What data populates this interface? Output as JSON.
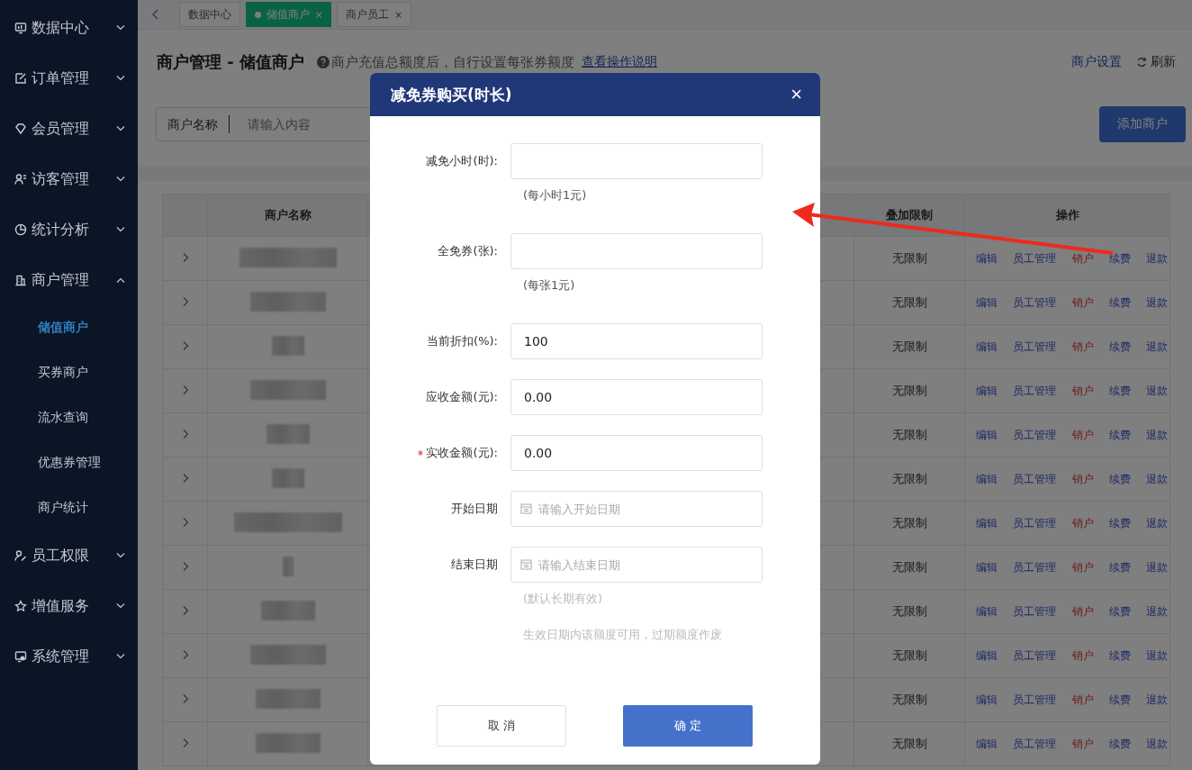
{
  "sidebar": {
    "items": [
      {
        "label": "数据中心",
        "expanded": false
      },
      {
        "label": "订单管理",
        "expanded": false
      },
      {
        "label": "会员管理",
        "expanded": false
      },
      {
        "label": "访客管理",
        "expanded": false
      },
      {
        "label": "统计分析",
        "expanded": false
      },
      {
        "label": "商户管理",
        "expanded": true,
        "children": [
          {
            "label": "储值商户",
            "selected": true
          },
          {
            "label": "买券商户",
            "selected": false
          },
          {
            "label": "流水查询",
            "selected": false
          },
          {
            "label": "优惠券管理",
            "selected": false
          },
          {
            "label": "商户统计",
            "selected": false
          }
        ]
      },
      {
        "label": "员工权限",
        "expanded": false
      },
      {
        "label": "增值服务",
        "expanded": false
      },
      {
        "label": "系统管理",
        "expanded": false
      }
    ]
  },
  "tabs": [
    {
      "label": "数据中心",
      "selected": false,
      "closable": false
    },
    {
      "label": "储值商户",
      "selected": true,
      "closable": true,
      "close": "×"
    },
    {
      "label": "商户员工",
      "selected": false,
      "closable": true,
      "close": "×"
    }
  ],
  "header": {
    "title": "商户管理 - 储值商户",
    "help": "商户充值总额度后，自行设置每张券额度",
    "help_link": "查看操作说明",
    "settings_link": "商户设置",
    "refresh": "刷新"
  },
  "filter": {
    "label": "商户名称",
    "placeholder": "请输入内容",
    "add_button": "添加商户"
  },
  "table": {
    "columns": [
      "商户名称",
      "叠加限制",
      "操作"
    ],
    "rows": [
      {
        "limit": "无限制",
        "actions": [
          {
            "label": "编辑",
            "kind": "link"
          },
          {
            "label": "员工管理",
            "kind": "link"
          },
          {
            "label": "销户",
            "kind": "danger"
          },
          {
            "label": "续费",
            "kind": "link"
          },
          {
            "label": "退款",
            "kind": "link"
          }
        ]
      },
      {
        "limit": "无限制",
        "actions": [
          {
            "label": "编辑",
            "kind": "link"
          },
          {
            "label": "员工管理",
            "kind": "link"
          },
          {
            "label": "销户",
            "kind": "danger"
          },
          {
            "label": "续费",
            "kind": "link"
          },
          {
            "label": "退款",
            "kind": "link"
          }
        ]
      },
      {
        "limit": "无限制",
        "actions": [
          {
            "label": "编辑",
            "kind": "link"
          },
          {
            "label": "员工管理",
            "kind": "link"
          },
          {
            "label": "销户",
            "kind": "danger"
          },
          {
            "label": "续费",
            "kind": "link"
          },
          {
            "label": "退款",
            "kind": "link"
          }
        ]
      },
      {
        "limit": "无限制",
        "actions": [
          {
            "label": "编辑",
            "kind": "link"
          },
          {
            "label": "员工管理",
            "kind": "link"
          },
          {
            "label": "销户",
            "kind": "danger"
          },
          {
            "label": "续费",
            "kind": "link"
          },
          {
            "label": "退款",
            "kind": "link"
          }
        ]
      },
      {
        "limit": "无限制",
        "actions": [
          {
            "label": "编辑",
            "kind": "link"
          },
          {
            "label": "员工管理",
            "kind": "link"
          },
          {
            "label": "销户",
            "kind": "danger"
          },
          {
            "label": "续费",
            "kind": "link"
          },
          {
            "label": "退款",
            "kind": "link"
          }
        ]
      },
      {
        "limit": "无限制",
        "actions": [
          {
            "label": "编辑",
            "kind": "link"
          },
          {
            "label": "员工管理",
            "kind": "link"
          },
          {
            "label": "销户",
            "kind": "danger"
          },
          {
            "label": "续费",
            "kind": "link"
          },
          {
            "label": "退款",
            "kind": "link"
          }
        ]
      },
      {
        "limit": "无限制",
        "actions": [
          {
            "label": "编辑",
            "kind": "link"
          },
          {
            "label": "员工管理",
            "kind": "link"
          },
          {
            "label": "销户",
            "kind": "danger"
          },
          {
            "label": "续费",
            "kind": "link"
          },
          {
            "label": "退款",
            "kind": "link"
          }
        ]
      },
      {
        "limit": "无限制",
        "actions": [
          {
            "label": "编辑",
            "kind": "link"
          },
          {
            "label": "员工管理",
            "kind": "link"
          },
          {
            "label": "销户",
            "kind": "danger"
          },
          {
            "label": "续费",
            "kind": "link"
          },
          {
            "label": "退款",
            "kind": "link"
          }
        ]
      },
      {
        "limit": "无限制",
        "actions": [
          {
            "label": "编辑",
            "kind": "link"
          },
          {
            "label": "员工管理",
            "kind": "link"
          },
          {
            "label": "销户",
            "kind": "danger"
          },
          {
            "label": "续费",
            "kind": "link"
          },
          {
            "label": "退款",
            "kind": "link"
          }
        ]
      },
      {
        "limit": "无限制",
        "actions": [
          {
            "label": "编辑",
            "kind": "link"
          },
          {
            "label": "员工管理",
            "kind": "link"
          },
          {
            "label": "销户",
            "kind": "danger"
          },
          {
            "label": "续费",
            "kind": "link"
          },
          {
            "label": "退款",
            "kind": "link"
          }
        ]
      },
      {
        "limit": "无限制",
        "actions": [
          {
            "label": "编辑",
            "kind": "link"
          },
          {
            "label": "员工管理",
            "kind": "link"
          },
          {
            "label": "销户",
            "kind": "danger"
          },
          {
            "label": "续费",
            "kind": "link"
          },
          {
            "label": "退款",
            "kind": "link"
          }
        ]
      },
      {
        "limit": "无限制",
        "actions": [
          {
            "label": "编辑",
            "kind": "link"
          },
          {
            "label": "员工管理",
            "kind": "link"
          },
          {
            "label": "销户",
            "kind": "danger"
          },
          {
            "label": "续费",
            "kind": "link"
          },
          {
            "label": "退款",
            "kind": "link"
          }
        ]
      }
    ]
  },
  "dialog": {
    "title": "减免券购买(时长)",
    "close": "×",
    "fields": [
      {
        "label": "减免小时(时):",
        "kind": "text",
        "required": false,
        "hints": [
          {
            "text": "(每小时1元)",
            "muted": false
          }
        ]
      },
      {
        "label": "全免券(张):",
        "kind": "text",
        "required": false,
        "hints": [
          {
            "text": "(每张1元)",
            "muted": false
          }
        ]
      },
      {
        "label": "当前折扣(%):",
        "kind": "text",
        "required": false,
        "value": "100"
      },
      {
        "label": "应收金额(元):",
        "kind": "text",
        "required": false,
        "value": "0.00"
      },
      {
        "label": "实收金额(元):",
        "kind": "text",
        "required": true,
        "value": "0.00"
      },
      {
        "label": "开始日期",
        "kind": "date",
        "required": false,
        "placeholder": "请输入开始日期"
      },
      {
        "label": "结束日期",
        "kind": "date",
        "required": false,
        "placeholder": "请输入结束日期",
        "hints": [
          {
            "text": "(默认长期有效)",
            "muted": true
          },
          {
            "text": "生效日期内该额度可用，过期额度作废",
            "muted": true
          }
        ]
      }
    ],
    "cancel": "取 消",
    "confirm": "确 定"
  }
}
